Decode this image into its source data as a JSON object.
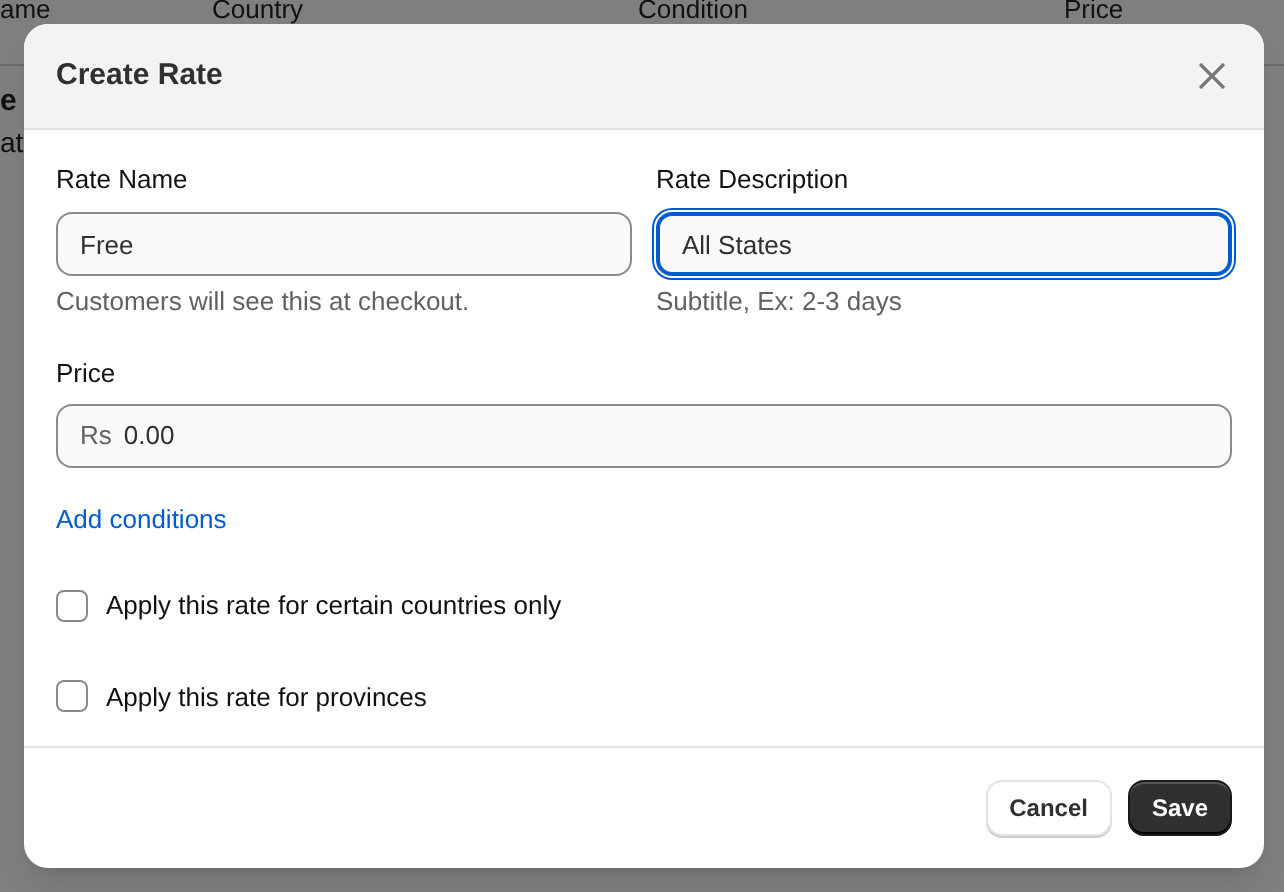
{
  "background_table": {
    "columns": [
      "ame",
      "Country",
      "Condition",
      "Price"
    ],
    "row_fragments": [
      "e",
      "at"
    ]
  },
  "dialog": {
    "title": "Create Rate",
    "fields": [
      {
        "label": "Rate Name",
        "value": "Free",
        "help": "Customers will see this at checkout.",
        "focused": false
      },
      {
        "label": "Rate Description",
        "value": "All States",
        "help": "Subtitle, Ex: 2-3 days",
        "focused": true
      }
    ],
    "price": {
      "label": "Price",
      "prefix": "Rs",
      "value": "0.00"
    },
    "link": "Add conditions",
    "options": [
      {
        "label": "Apply this rate for certain countries only",
        "checked": false
      },
      {
        "label": "Apply this rate for provinces",
        "checked": false
      }
    ],
    "buttons": [
      {
        "label": "Cancel",
        "kind": "secondary"
      },
      {
        "label": "Save",
        "kind": "primary"
      }
    ]
  }
}
